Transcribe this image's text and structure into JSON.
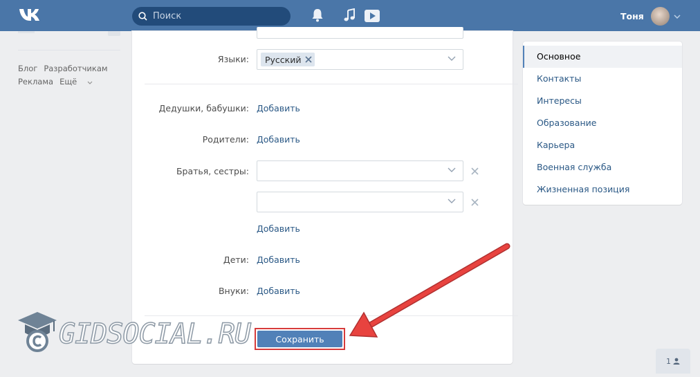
{
  "header": {
    "search_placeholder": "Поиск",
    "user_name": "Тоня",
    "icons": [
      "vk-logo-icon",
      "search-icon",
      "bell-icon",
      "music-icon",
      "video-icon",
      "chevron-down-icon"
    ]
  },
  "left_menu": {
    "links": [
      "Блог",
      "Разработчикам",
      "Реклама",
      "Ещё"
    ]
  },
  "form": {
    "languages_label": "Языки:",
    "languages_chip": "Русский",
    "grandparents_label": "Дедушки, бабушки:",
    "parents_label": "Родители:",
    "siblings_label": "Братья, сестры:",
    "children_label": "Дети:",
    "grandchildren_label": "Внуки:",
    "add_link": "Добавить",
    "save_label": "Сохранить"
  },
  "right_menu": {
    "items": [
      "Основное",
      "Контакты",
      "Интересы",
      "Образование",
      "Карьера",
      "Военная служба",
      "Жизненная позиция"
    ],
    "active": "Основное"
  },
  "counter": {
    "value": "1"
  },
  "watermark": {
    "text": "GIDSOCIAL.RU"
  },
  "colors": {
    "header": "#4a76a8",
    "link": "#2a5885",
    "button": "#5181b8",
    "highlight": "#d63b3b"
  }
}
